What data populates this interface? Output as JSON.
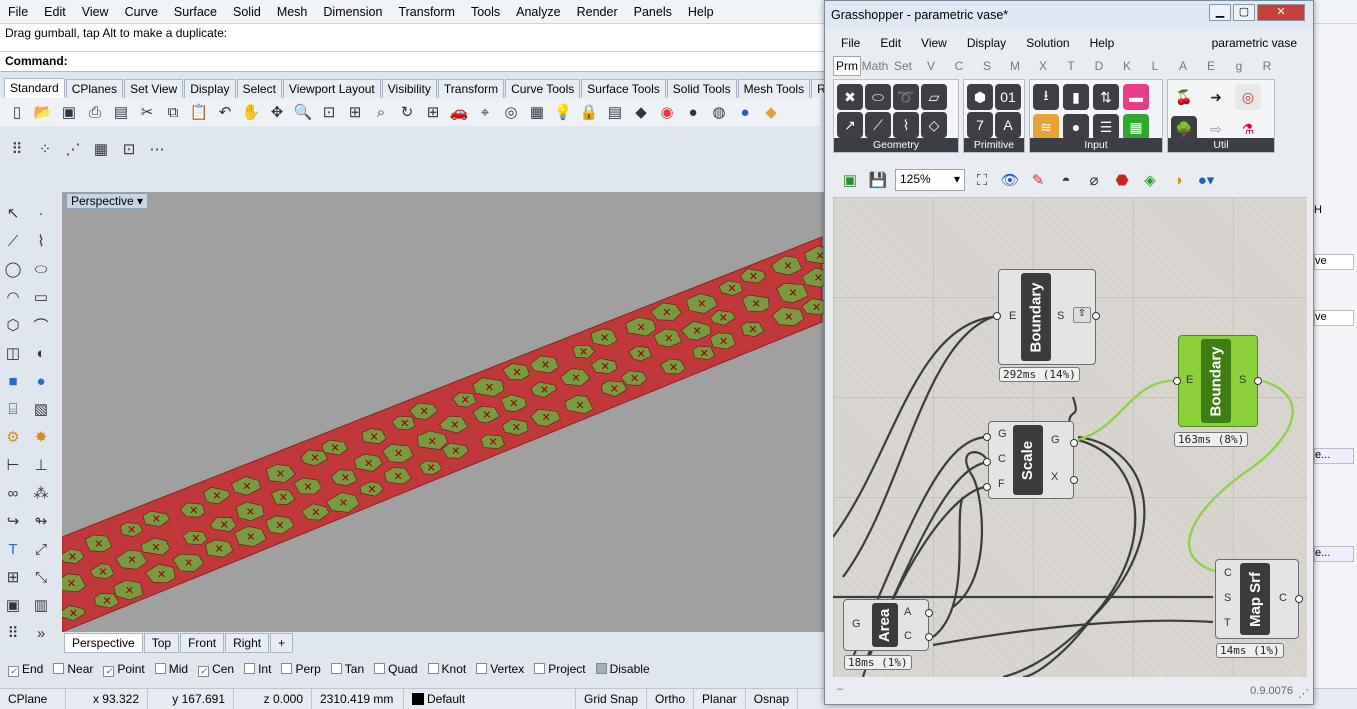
{
  "rhino": {
    "menu": [
      "File",
      "Edit",
      "View",
      "Curve",
      "Surface",
      "Solid",
      "Mesh",
      "Dimension",
      "Transform",
      "Tools",
      "Analyze",
      "Render",
      "Panels",
      "Help"
    ],
    "command_history": "Drag gumball, tap Alt to make a duplicate:",
    "command_prompt": "Command:",
    "tabs": [
      "Standard",
      "CPlanes",
      "Set View",
      "Display",
      "Select",
      "Viewport Layout",
      "Visibility",
      "Transform",
      "Curve Tools",
      "Surface Tools",
      "Solid Tools",
      "Mesh Tools",
      "R"
    ],
    "viewport_title": "Perspective",
    "viewport_tabs": [
      "Perspective",
      "Top",
      "Front",
      "Right",
      "+"
    ],
    "osnaps": [
      {
        "label": "End",
        "on": true
      },
      {
        "label": "Near",
        "on": false
      },
      {
        "label": "Point",
        "on": true
      },
      {
        "label": "Mid",
        "on": false
      },
      {
        "label": "Cen",
        "on": true
      },
      {
        "label": "Int",
        "on": false
      },
      {
        "label": "Perp",
        "on": false
      },
      {
        "label": "Tan",
        "on": false
      },
      {
        "label": "Quad",
        "on": false
      },
      {
        "label": "Knot",
        "on": false
      },
      {
        "label": "Vertex",
        "on": false
      },
      {
        "label": "Project",
        "on": false
      },
      {
        "label": "Disable",
        "on": false
      }
    ],
    "status": {
      "cplane": "CPlane",
      "x": "x 93.322",
      "y": "y 167.691",
      "z": "z 0.000",
      "dist": "2310.419 mm",
      "layer": "Default",
      "grid": "Grid Snap",
      "ortho": "Ortho",
      "planar": "Planar",
      "osnap": "Osnap"
    },
    "right_panel": [
      "H",
      "ve",
      "ve",
      "e...",
      "e..."
    ]
  },
  "grasshopper": {
    "title": "Grasshopper - parametric vase*",
    "document": "parametric vase",
    "menu": [
      "File",
      "Edit",
      "View",
      "Display",
      "Solution",
      "Help"
    ],
    "tabs": [
      "Prm",
      "Math",
      "Set",
      "V",
      "C",
      "S",
      "M",
      "X",
      "T",
      "D",
      "K",
      "L",
      "A",
      "E",
      "g",
      "R"
    ],
    "groups": [
      "Geometry",
      "Primitive",
      "Input",
      "Util"
    ],
    "zoom": "125%",
    "version": "0.9.0076",
    "components": {
      "boundary1": {
        "name": "Boundary",
        "in": "E",
        "out": "S",
        "time": "292ms (14%)"
      },
      "boundary2": {
        "name": "Boundary",
        "in": "E",
        "out": "S",
        "time": "163ms (8%)"
      },
      "scale": {
        "name": "Scale",
        "in": [
          "G",
          "C",
          "F"
        ],
        "out": [
          "G",
          "X"
        ]
      },
      "area": {
        "name": "Area",
        "in": "G",
        "out": [
          "A",
          "C"
        ],
        "time": "18ms (1%)"
      },
      "mapsrf": {
        "name": "Map Srf",
        "in": [
          "C",
          "S",
          "T"
        ],
        "out": "C",
        "time": "14ms (1%)"
      }
    }
  },
  "colors": {
    "panel_red": "#c0383a",
    "panel_green": "#7a9a40",
    "gh_green": "#8bd23a"
  }
}
